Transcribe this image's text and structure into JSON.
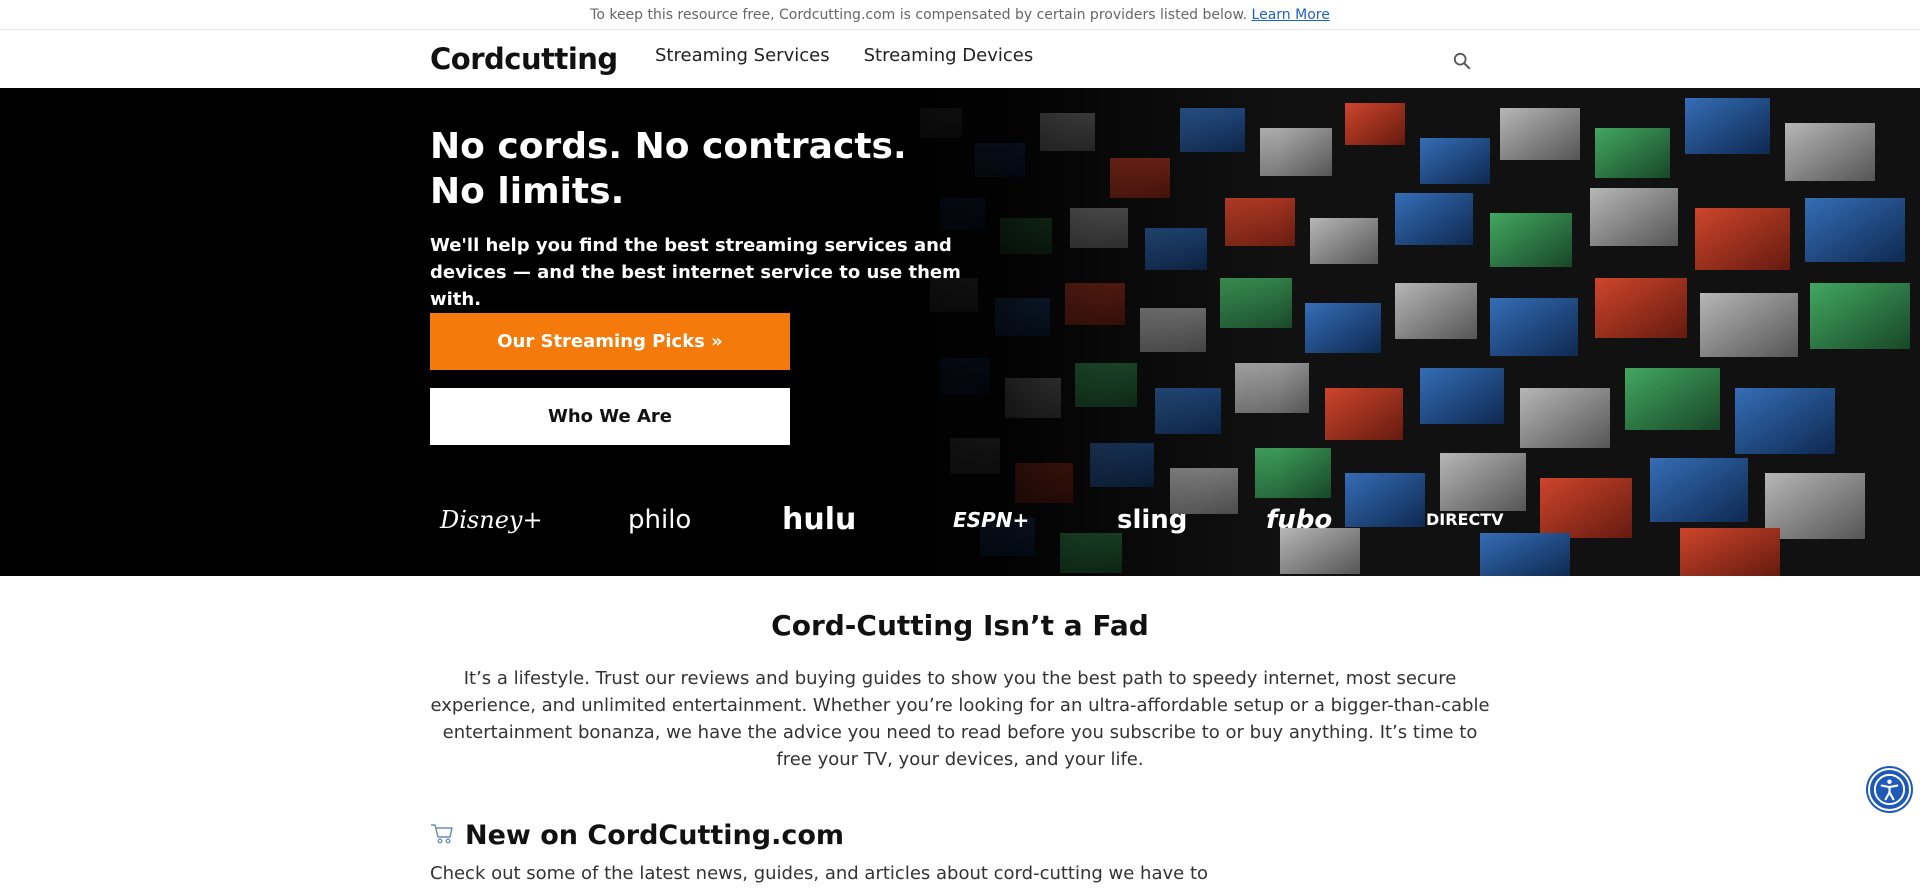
{
  "disclosure": {
    "text": "To keep this resource free, Cordcutting.com is compensated by certain providers listed below.",
    "link": "Learn More"
  },
  "header": {
    "logo": "Cordcutting",
    "nav": [
      "Streaming Services",
      "Streaming Devices"
    ],
    "search_icon": "search-icon"
  },
  "hero": {
    "headline_line1": "No cords. No contracts.",
    "headline_line2": "No limits.",
    "subtext": "We'll help you find the best streaming services and devices — and the best internet service to use them with.",
    "primary_button": "Our Streaming Picks »",
    "secondary_button": "Who We Are",
    "brands": [
      "Disney+",
      "philo",
      "hulu",
      "ESPN+",
      "sling",
      "fubo",
      "DIRECTV"
    ],
    "colors": {
      "primary": "#f47b0b",
      "background": "#000000"
    }
  },
  "intro": {
    "title": "Cord-Cutting Isn’t a Fad",
    "text": "It’s a lifestyle. Trust our reviews and buying guides to show you the best path to speedy internet, most secure experience, and unlimited entertainment. Whether you’re looking for an ultra-affordable setup or a bigger-than-cable entertainment bonanza, we have the advice you need to read before you subscribe to or buy anything. It’s time to free your TV, your devices, and your life."
  },
  "new_section": {
    "title": "New on CordCutting.com",
    "text": "Check out some of the latest news, guides, and articles about cord-cutting we have to"
  },
  "accessibility_icon": "accessibility-icon"
}
